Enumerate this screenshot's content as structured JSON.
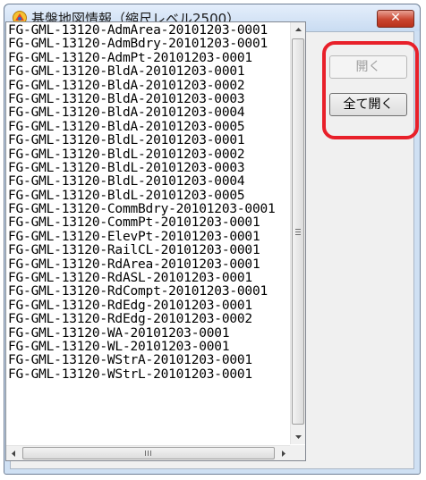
{
  "window": {
    "title": "基盤地図情報（縮尺レベル2500）",
    "close_label": "✕"
  },
  "file_list": {
    "items": [
      "FG-GML-13120-AdmArea-20101203-0001",
      "FG-GML-13120-AdmBdry-20101203-0001",
      "FG-GML-13120-AdmPt-20101203-0001",
      "FG-GML-13120-BldA-20101203-0001",
      "FG-GML-13120-BldA-20101203-0002",
      "FG-GML-13120-BldA-20101203-0003",
      "FG-GML-13120-BldA-20101203-0004",
      "FG-GML-13120-BldA-20101203-0005",
      "FG-GML-13120-BldL-20101203-0001",
      "FG-GML-13120-BldL-20101203-0002",
      "FG-GML-13120-BldL-20101203-0003",
      "FG-GML-13120-BldL-20101203-0004",
      "FG-GML-13120-BldL-20101203-0005",
      "FG-GML-13120-CommBdry-20101203-0001",
      "FG-GML-13120-CommPt-20101203-0001",
      "FG-GML-13120-ElevPt-20101203-0001",
      "FG-GML-13120-RailCL-20101203-0001",
      "FG-GML-13120-RdArea-20101203-0001",
      "FG-GML-13120-RdASL-20101203-0001",
      "FG-GML-13120-RdCompt-20101203-0001",
      "FG-GML-13120-RdEdg-20101203-0001",
      "FG-GML-13120-RdEdg-20101203-0002",
      "FG-GML-13120-WA-20101203-0001",
      "FG-GML-13120-WL-20101203-0001",
      "FG-GML-13120-WStrA-20101203-0001",
      "FG-GML-13120-WStrL-20101203-0001"
    ]
  },
  "buttons": {
    "open_label": "開く",
    "open_all_label": "全て開く",
    "open_enabled": false
  },
  "colors": {
    "highlight": "#e8202a",
    "title_bar": "#cfe0f3",
    "close_button": "#c9452f"
  }
}
